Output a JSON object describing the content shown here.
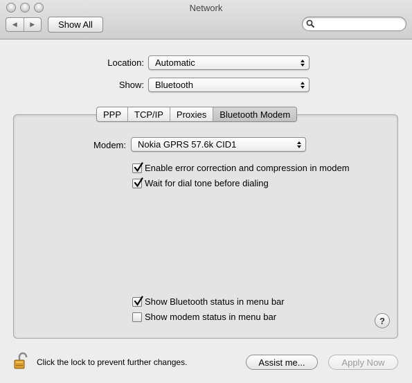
{
  "window": {
    "title": "Network"
  },
  "toolbar": {
    "back_icon": "back-arrow",
    "forward_icon": "forward-arrow",
    "show_all_label": "Show All",
    "search_value": "",
    "search_placeholder": ""
  },
  "location": {
    "label": "Location:",
    "value": "Automatic"
  },
  "show": {
    "label": "Show:",
    "value": "Bluetooth"
  },
  "tabs": [
    {
      "label": "PPP",
      "selected": false
    },
    {
      "label": "TCP/IP",
      "selected": false
    },
    {
      "label": "Proxies",
      "selected": false
    },
    {
      "label": "Bluetooth Modem",
      "selected": true
    }
  ],
  "modem": {
    "label": "Modem:",
    "value": "Nokia GPRS 57.6k CID1"
  },
  "options": [
    {
      "label": "Enable error correction and compression in modem",
      "checked": true
    },
    {
      "label": "Wait for dial tone before dialing",
      "checked": true
    }
  ],
  "status_options": [
    {
      "label": "Show Bluetooth status in menu bar",
      "checked": true
    },
    {
      "label": "Show modem status in menu bar",
      "checked": false
    }
  ],
  "help_label": "?",
  "footer": {
    "lock_text": "Click the lock to prevent further changes.",
    "assist_label": "Assist me...",
    "apply_label": "Apply Now"
  }
}
